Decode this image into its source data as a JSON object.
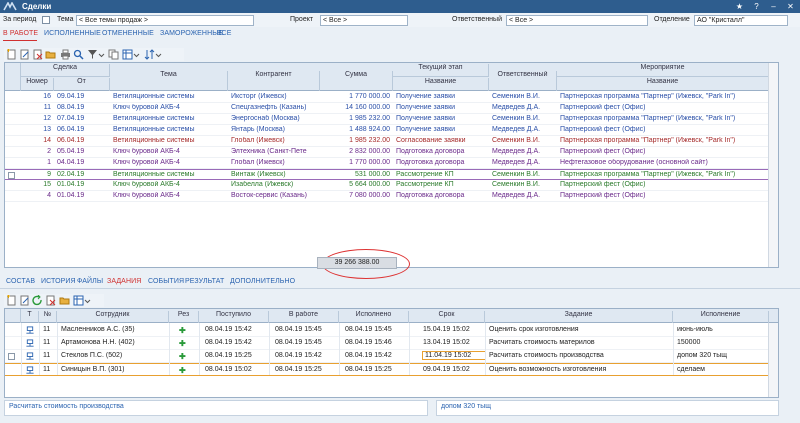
{
  "window": {
    "title": "Сделки"
  },
  "filters": {
    "period_label": "За период",
    "theme_label": "Тема",
    "theme_value": "< Все темы продаж >",
    "project_label": "Проект",
    "project_value": "< Все >",
    "responsible_label": "Ответственный",
    "responsible_value": "< Все >",
    "department_label": "Отделение",
    "department_value": "АО \"Кристалл\""
  },
  "top_tabs": [
    "В РАБОТЕ",
    "ИСПОЛНЕННЫЕ",
    "ОТМЕНЕННЫЕ",
    "ЗАМОРОЖЕННЫЕ",
    "ВСЕ"
  ],
  "deals_headers": {
    "deal": "Сделка",
    "number": "Номер",
    "from": "От",
    "theme": "Тема",
    "counterparty": "Контрагент",
    "sum": "Сумма",
    "stage": "Текущий этап",
    "stage_name": "Название",
    "responsible": "Ответственный",
    "event": "Мероприятие",
    "event_name": "Название"
  },
  "deals": [
    {
      "num": "16",
      "date": "09.04.19",
      "theme": "Ветиляционные системы",
      "party": "Иксторг (Ижевск)",
      "sum": "1 770 000.00",
      "stage": "Получение заявки",
      "resp": "Семенкин В.И.",
      "event": "Партнерская программа \"Партнер\" (Ижевск, \"Park In\")",
      "color": "#2a4fa8"
    },
    {
      "num": "11",
      "date": "08.04.19",
      "theme": "Ключ буровой АКБ-4",
      "party": "Спецгазнефть (Казань)",
      "sum": "14 160 000.00",
      "stage": "Получение заявки",
      "resp": "Медведев Д.А.",
      "event": "Партнерский фест (Офис)",
      "color": "#2a4fa8"
    },
    {
      "num": "12",
      "date": "07.04.19",
      "theme": "Ветиляционные системы",
      "party": "Энергоснаб (Москва)",
      "sum": "1 985 232.00",
      "stage": "Получение заявки",
      "resp": "Семенкин В.И.",
      "event": "Партнерская программа \"Партнер\" (Ижевск, \"Park In\")",
      "color": "#2a4fa8"
    },
    {
      "num": "13",
      "date": "06.04.19",
      "theme": "Ветиляционные системы",
      "party": "Янтарь (Москва)",
      "sum": "1 488 924.00",
      "stage": "Получение заявки",
      "resp": "Медведев Д.А.",
      "event": "Партнерский фест (Офис)",
      "color": "#2a4fa8"
    },
    {
      "num": "14",
      "date": "06.04.19",
      "theme": "Ветиляционные системы",
      "party": "Глобал (Ижевск)",
      "sum": "1 985 232.00",
      "stage": "Согласование заявки",
      "resp": "Семенкин В.И.",
      "event": "Партнерская программа \"Партнер\" (Ижевск, \"Park In\")",
      "color": "#a52a2a"
    },
    {
      "num": "2",
      "date": "05.04.19",
      "theme": "Ключ буровой АКБ-4",
      "party": "Элтехника (Санкт-Пете",
      "sum": "2 832 000.00",
      "stage": "Подготовка договора",
      "resp": "Медведев Д.А.",
      "event": "Партнерский фест (Офис)",
      "color": "#6a2a8a"
    },
    {
      "num": "1",
      "date": "04.04.19",
      "theme": "Ключ буровой АКБ-4",
      "party": "Глобал (Ижевск)",
      "sum": "1 770 000.00",
      "stage": "Подготовка договора",
      "resp": "Медведев Д.А.",
      "event": "Нефтегазовое оборудование (основной сайт)",
      "color": "#6a2a8a"
    },
    {
      "num": "9",
      "date": "02.04.19",
      "theme": "Ветиляционные системы",
      "party": "Винтаж (Ижевск)",
      "sum": "531 000.00",
      "stage": "Рассмотрение КП",
      "resp": "Семенкин В.И.",
      "event": "Партнерская программа \"Партнер\" (Ижевск, \"Park In\")",
      "color": "#2a7a2a"
    },
    {
      "num": "15",
      "date": "01.04.19",
      "theme": "Ключ буровой АКБ-4",
      "party": "Изабелла (Ижевск)",
      "sum": "5 664 000.00",
      "stage": "Рассмотрение КП",
      "resp": "Семенкин В.И.",
      "event": "Партнерский фест (Офис)",
      "color": "#2a7a2a"
    },
    {
      "num": "4",
      "date": "01.04.19",
      "theme": "Ключ буровой АКБ-4",
      "party": "Восток-сервис (Казань)",
      "sum": "7 080 000.00",
      "stage": "Подготовка договора",
      "resp": "Медведев Д.А.",
      "event": "Партнерский фест (Офис)",
      "color": "#6a2a8a"
    }
  ],
  "total": "39 266 388.00",
  "bottom_tabs": [
    "СОСТАВ",
    "ИСТОРИЯ",
    "ФАЙЛЫ",
    "ЗАДАНИЯ",
    "СОБЫТИЯ",
    "РЕЗУЛЬТАТ",
    "ДОПОЛНИТЕЛЬНО"
  ],
  "tasks_headers": {
    "t": "Т",
    "no": "№",
    "employee": "Сотрудник",
    "rez": "Рез",
    "received": "Поступило",
    "in_work": "В работе",
    "done": "Исполнено",
    "due": "Срок",
    "task": "Задание",
    "execution": "Исполнение"
  },
  "tasks": [
    {
      "no": "11",
      "employee": "Масленников А.С. (35)",
      "received": "08.04.19 15:42",
      "in_work": "08.04.19 15:45",
      "done": "08.04.19 15:45",
      "due": "15.04.19 15:02",
      "task": "Оценить срок изготовления",
      "exec": "июнь-июль"
    },
    {
      "no": "11",
      "employee": "Артамонова Н.Н. (402)",
      "received": "08.04.19 15:42",
      "in_work": "08.04.19 15:45",
      "done": "08.04.19 15:46",
      "due": "13.04.19 15:02",
      "task": "Расчитать стоимость материлов",
      "exec": "150000"
    },
    {
      "no": "11",
      "employee": "Стеклов П.С. (502)",
      "received": "08.04.19 15:25",
      "in_work": "08.04.19 15:42",
      "done": "08.04.19 15:42",
      "due": "11.04.19 15:02",
      "task": "Расчитать стоимость производства",
      "exec": "допом 320 тыщ"
    },
    {
      "no": "11",
      "employee": "Синицын В.П. (301)",
      "received": "08.04.19 15:02",
      "in_work": "08.04.19 15:25",
      "done": "08.04.19 15:25",
      "due": "09.04.19 15:02",
      "task": "Оценить возможность изготовления",
      "exec": "сделаем"
    }
  ],
  "bottom_left_text": "Расчитать стоимость производства",
  "bottom_right_text": "допом 320 тыщ",
  "colors": {
    "accent": "#2e5d8e",
    "active_tab": "#d03030",
    "add_green": "#2a9a3a"
  }
}
